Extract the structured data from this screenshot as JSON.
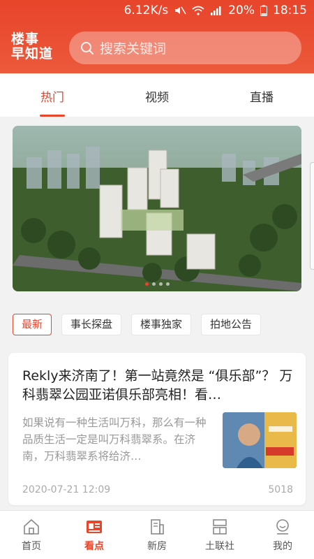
{
  "status_bar": {
    "speed": "6.12K/s",
    "battery": "20%",
    "time": "18:15"
  },
  "header": {
    "logo_line1": "楼事",
    "logo_line2": "早知道",
    "search_placeholder": "搜索关键词"
  },
  "tabs": [
    {
      "label": "热门",
      "active": true
    },
    {
      "label": "视频",
      "active": false
    },
    {
      "label": "直播",
      "active": false
    }
  ],
  "banner": {
    "dots": 4,
    "active_dot": 0
  },
  "chips": [
    {
      "label": "最新",
      "active": true
    },
    {
      "label": "事长探盘",
      "active": false
    },
    {
      "label": "楼事独家",
      "active": false
    },
    {
      "label": "拍地公告",
      "active": false
    }
  ],
  "article": {
    "title": "Rekly来济南了！第一站竟然是 “俱乐部”？ 万科翡翠公园亚诺俱乐部亮相！看…",
    "excerpt": "如果说有一种生活叫万科，那么有一种品质生活一定是叫万科翡翠系。在济南，万科翡翠系将给济…",
    "date": "2020-07-21 12:09",
    "views": "5018"
  },
  "bottom_nav": [
    {
      "label": "首页",
      "icon": "home-icon",
      "active": false
    },
    {
      "label": "看点",
      "icon": "news-icon",
      "active": true
    },
    {
      "label": "新房",
      "icon": "building-icon",
      "active": false
    },
    {
      "label": "土联社",
      "icon": "land-icon",
      "active": false
    },
    {
      "label": "我的",
      "icon": "profile-icon",
      "active": false
    }
  ],
  "colors": {
    "accent": "#e8452b",
    "header_bg": "#ea5034",
    "background": "#f2f2f2"
  }
}
